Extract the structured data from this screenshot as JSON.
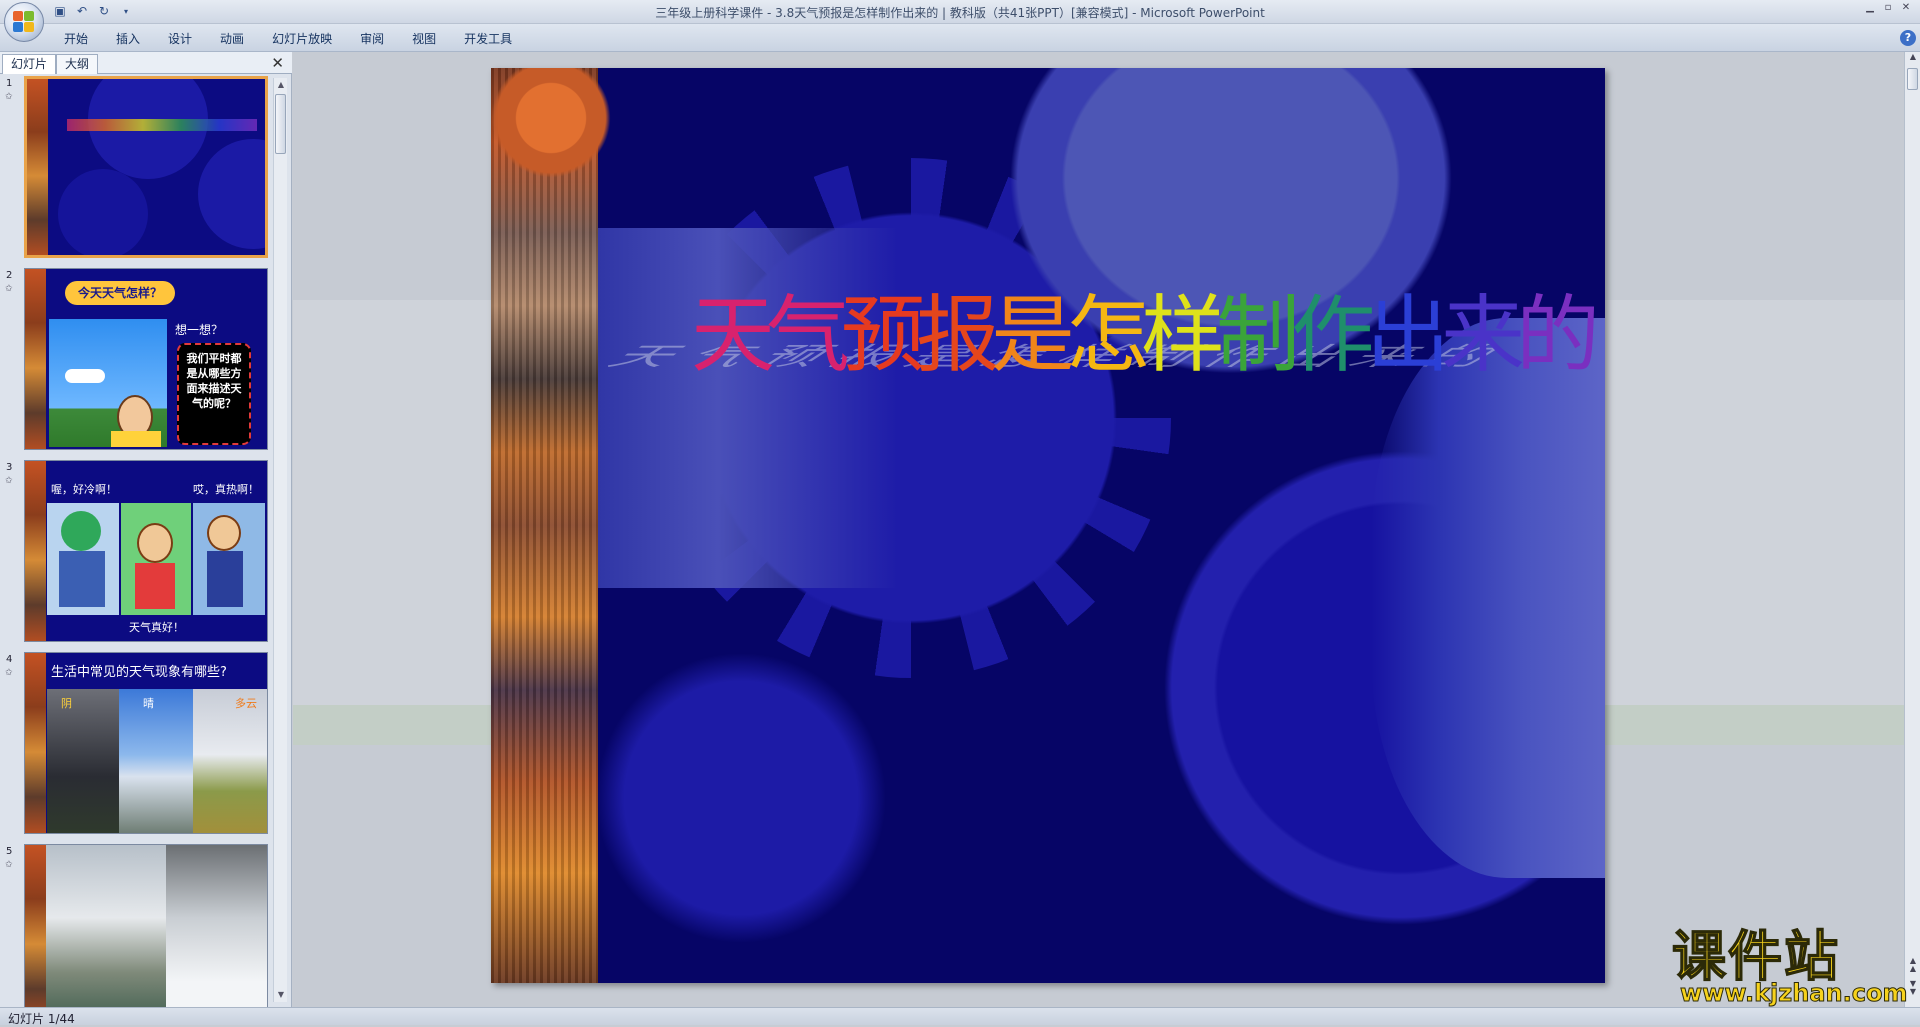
{
  "window": {
    "title": "三年级上册科学课件 - 3.8天气预报是怎样制作出来的 | 教科版（共41张PPT）[兼容模式] - Microsoft PowerPoint",
    "controls": [
      "minimize",
      "restore",
      "close"
    ]
  },
  "quick_access": [
    {
      "name": "save-icon",
      "glyph": "💾"
    },
    {
      "name": "undo-icon",
      "glyph": "↶"
    },
    {
      "name": "redo-icon",
      "glyph": "↻"
    },
    {
      "name": "customize-icon",
      "glyph": "▾"
    }
  ],
  "ribbon": {
    "tabs": [
      "开始",
      "插入",
      "设计",
      "动画",
      "幻灯片放映",
      "审阅",
      "视图",
      "开发工具"
    ],
    "help_glyph": "?"
  },
  "panel": {
    "tabs": [
      "幻灯片",
      "大纲"
    ],
    "close_glyph": "✕"
  },
  "thumbnails": [
    {
      "number": "1",
      "star": "✩",
      "selected": true
    },
    {
      "number": "2",
      "star": "✩",
      "bubble": "今天天气怎样？",
      "think": "想一想？",
      "box": "我们平时都是从哪些方面来描述天气的呢？"
    },
    {
      "number": "3",
      "star": "✩",
      "left_cap": "喔，好冷啊！",
      "right_cap": "哎，真热啊！",
      "bottom_cap": "天气真好！"
    },
    {
      "number": "4",
      "star": "✩",
      "title": "生活中常见的天气现象有哪些?",
      "labels": [
        "阴",
        "晴",
        "多云"
      ]
    },
    {
      "number": "5",
      "star": "✩"
    }
  ],
  "slide": {
    "headline_chars": [
      {
        "ch": "天",
        "color": "#d8226e"
      },
      {
        "ch": "气",
        "color": "#d8226e"
      },
      {
        "ch": "预",
        "color": "#e63a20"
      },
      {
        "ch": "报",
        "color": "#e5461c"
      },
      {
        "ch": "是",
        "color": "#f0851a"
      },
      {
        "ch": "怎",
        "color": "#f5b712"
      },
      {
        "ch": "样",
        "color": "#dfe21a"
      },
      {
        "ch": "制",
        "color": "#3aa43a"
      },
      {
        "ch": "作",
        "color": "#1f8f6b"
      },
      {
        "ch": "出",
        "color": "#2b3fd6"
      },
      {
        "ch": "来",
        "color": "#4a33c8"
      },
      {
        "ch": "的",
        "color": "#7a2fc0"
      }
    ],
    "headline_shadow": "天气预报是怎样制作出来的"
  },
  "watermark": {
    "brand": "课件站",
    "url": "www.kjzhan.com"
  },
  "status": {
    "slide_counter": "幻灯片 1/44"
  }
}
